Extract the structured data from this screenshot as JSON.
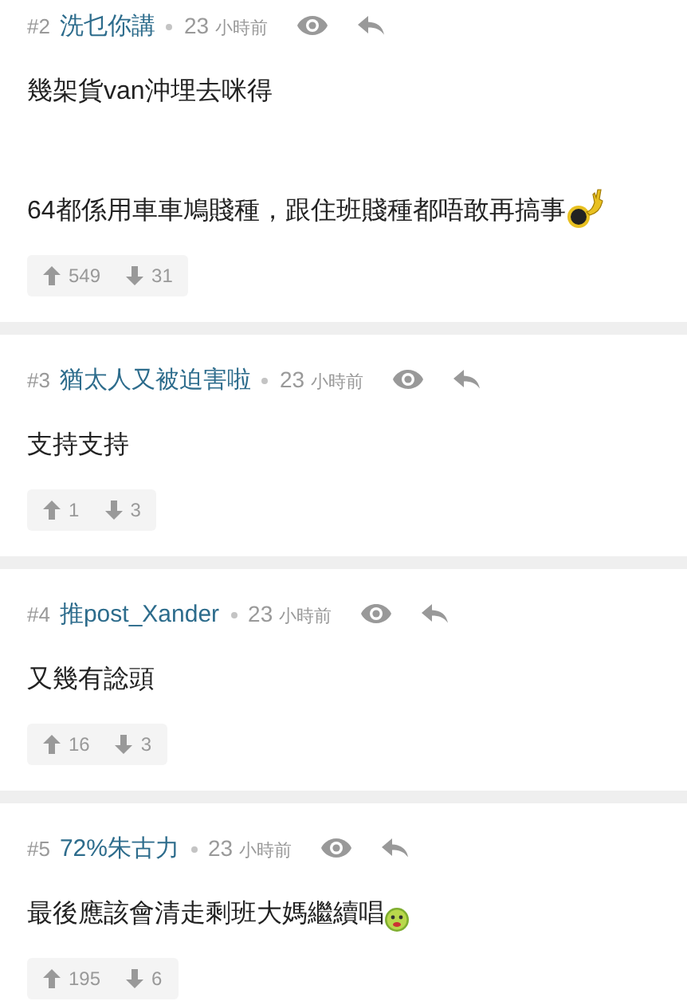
{
  "posts": [
    {
      "number": "#2",
      "author": "洗乜你講",
      "time_num": "23",
      "time_unit": "小時前",
      "paragraphs": [
        {
          "text": "幾架貨**van**沖埋去咪得",
          "kind": "plain"
        },
        {
          "text": "**64**都係用車車鳩賤種，跟住班賤種都唔敢再搞事",
          "kind": "dark-emoji"
        }
      ],
      "upvotes": "549",
      "downvotes": "31"
    },
    {
      "number": "#3",
      "author": "猶太人又被迫害啦",
      "time_num": "23",
      "time_unit": "小時前",
      "paragraphs": [
        {
          "text": "支持支持",
          "kind": "plain"
        }
      ],
      "upvotes": "1",
      "downvotes": "3"
    },
    {
      "number": "#4",
      "author": "推post_Xander",
      "time_num": "23",
      "time_unit": "小時前",
      "paragraphs": [
        {
          "text": "又幾有諗頭",
          "kind": "plain"
        }
      ],
      "upvotes": "16",
      "downvotes": "3"
    },
    {
      "number": "#5",
      "author": "72%朱古力",
      "time_num": "23",
      "time_unit": "小時前",
      "paragraphs": [
        {
          "text": "最後應該會清走剩班大媽繼續唱",
          "kind": "green-emoji"
        }
      ],
      "upvotes": "195",
      "downvotes": "6"
    }
  ]
}
